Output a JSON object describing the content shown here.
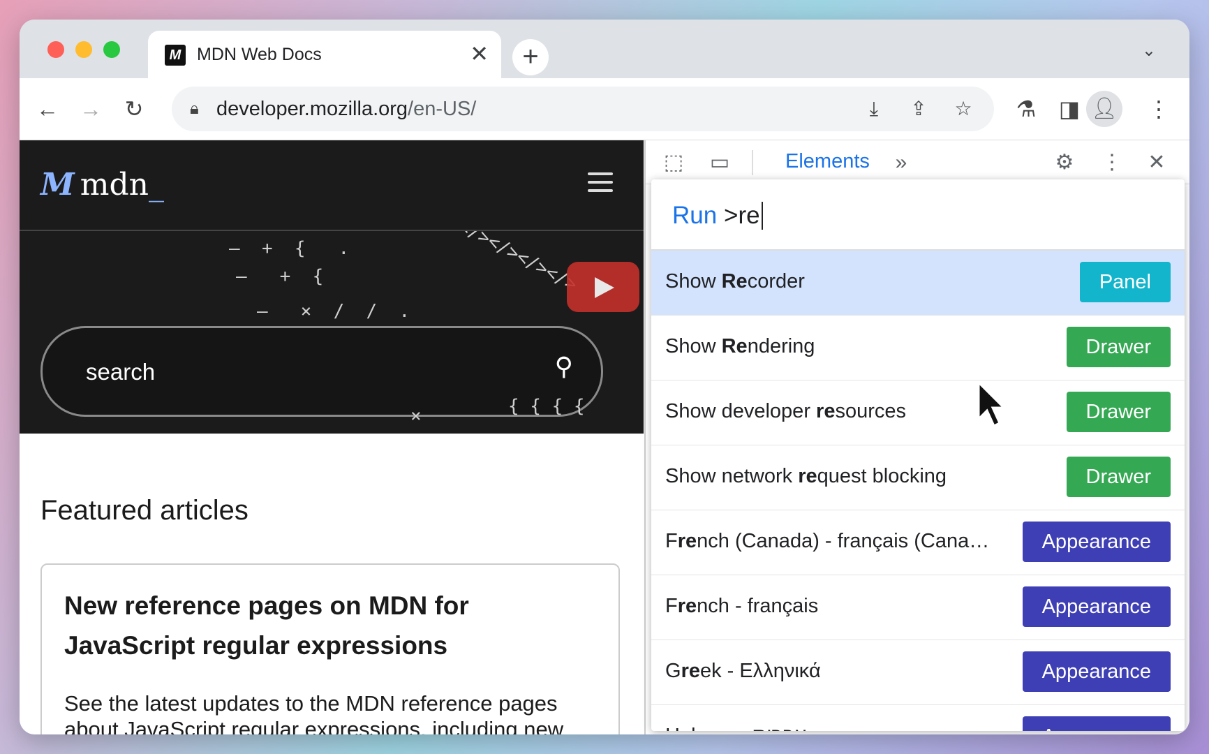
{
  "browser": {
    "tab_title": "MDN Web Docs",
    "tab_favicon": "M",
    "close_glyph": "✕",
    "newtab_glyph": "+",
    "tab_menu_glyph": "⌄",
    "url_host": "developer.mozilla.org",
    "url_path": "/en-US/",
    "icons": [
      "back-icon",
      "forward-icon",
      "reload-icon",
      "lock-icon",
      "install-icon",
      "share-icon",
      "star-icon",
      "labs-icon",
      "sidepanel-icon",
      "profile-icon",
      "menu-icon"
    ]
  },
  "page": {
    "logo_text": "mdn",
    "logo_cursor": "_",
    "search_placeholder": "search",
    "featured_heading": "Featured articles",
    "card_title": "New reference pages on MDN for JavaScript regular expressions",
    "card_desc": "See the latest updates to the MDN reference pages about JavaScript regular expressions, including new sections on sub-features a"
  },
  "devtools": {
    "active_tab": "Elements",
    "more_tabs_glyph": "»"
  },
  "palette": {
    "prefix": "Run",
    "query": ">re",
    "items": [
      {
        "pre": "Show ",
        "bold": "Re",
        "post": "corder",
        "badge": "Panel",
        "type": "panel",
        "selected": true
      },
      {
        "pre": "Show ",
        "bold": "Re",
        "post": "ndering",
        "badge": "Drawer",
        "type": "drawer"
      },
      {
        "pre": "Show developer ",
        "bold": "re",
        "post": "sources",
        "badge": "Drawer",
        "type": "drawer"
      },
      {
        "pre": "Show network ",
        "bold": "re",
        "post": "quest blocking",
        "badge": "Drawer",
        "type": "drawer"
      },
      {
        "pre": "F",
        "bold": "re",
        "post": "nch (Canada) - français (Cana…",
        "badge": "Appearance",
        "type": "appearance"
      },
      {
        "pre": "F",
        "bold": "re",
        "post": "nch - français",
        "badge": "Appearance",
        "type": "appearance"
      },
      {
        "pre": "G",
        "bold": "re",
        "post": "ek - Ελληνικά",
        "badge": "Appearance",
        "type": "appearance"
      },
      {
        "pre": "Hebrew - ",
        "bold": "",
        "post": "עברית",
        "badge": "Appearance",
        "type": "appearance"
      }
    ]
  },
  "colors": {
    "panel": "#12b5cb",
    "drawer": "#34a853",
    "appearance": "#3f3fb5",
    "accent": "#1a73e8"
  }
}
